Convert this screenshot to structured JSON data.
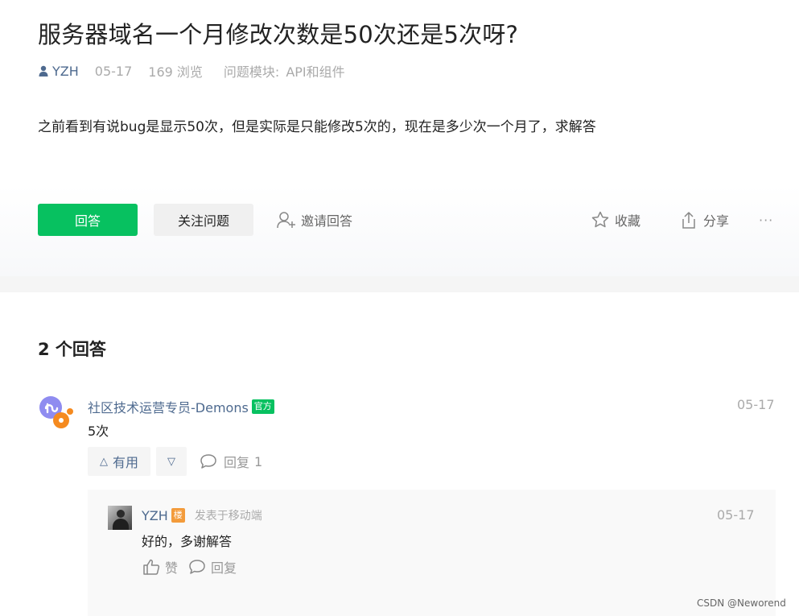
{
  "question": {
    "title": "服务器域名一个月修改次数是50次还是5次呀?",
    "author": "YZH",
    "date": "05-17",
    "views": "169 浏览",
    "module_label": "问题模块:",
    "module_value": "API和组件",
    "body": "之前看到有说bug是显示50次，但是实际是只能修改5次的，现在是多少次一个月了，求解答"
  },
  "actions": {
    "answer_label": "回答",
    "follow_label": "关注问题",
    "invite_label": "邀请回答",
    "collect_label": "收藏",
    "share_label": "分享",
    "more_label": "···"
  },
  "answers": {
    "count_label": "2 个回答",
    "items": [
      {
        "author": "社区技术运营专员-Demons",
        "badge": "官方",
        "date": "05-17",
        "body": "5次",
        "useful_label": "有用",
        "down_glyph": "▽",
        "up_glyph": "△",
        "reply_label": "回复",
        "reply_count": "1",
        "replies": [
          {
            "author": "YZH",
            "badge": "楼",
            "source": "发表于移动端",
            "date": "05-17",
            "body": "好的，多谢解答",
            "like_label": "赞",
            "reply_label": "回复"
          }
        ]
      }
    ]
  },
  "watermark": "CSDN @Neworend",
  "colors": {
    "accent_green": "#07c160",
    "link_blue": "#4e6a8f",
    "floor_orange": "#f39b3b"
  }
}
